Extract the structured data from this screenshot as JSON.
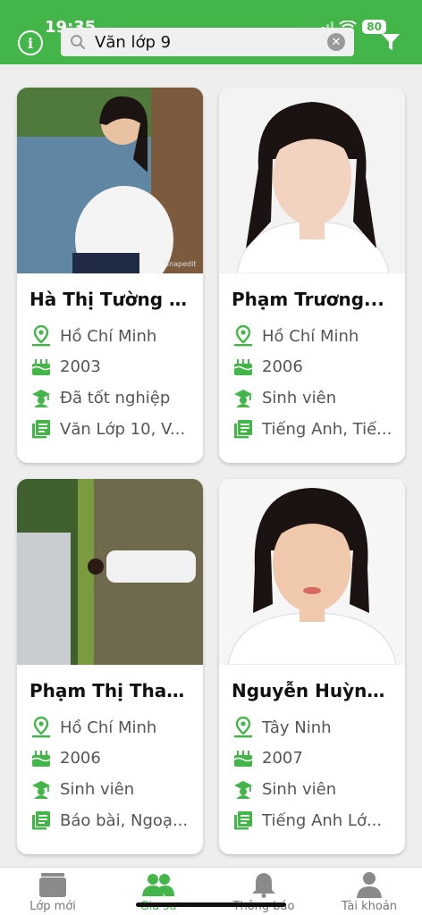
{
  "status_bar": {
    "time": "19:35",
    "battery": "80"
  },
  "header": {
    "search": {
      "value": "Văn lớp 9"
    },
    "clear_icon": "close-circle-icon",
    "info_icon": "info-icon",
    "filter_icon": "filter-icon"
  },
  "tutors": [
    {
      "name": "Hà Thị Tường Vy",
      "location": "Hồ Chí Minh",
      "birth_year": "2003",
      "status": "Đã tốt nghiệp",
      "subjects": "Văn Lớp 10, V..."
    },
    {
      "name": "Phạm Trương...",
      "location": "Hồ Chí Minh",
      "birth_year": "2006",
      "status": "Sinh viên",
      "subjects": "Tiếng Anh, Tiế..."
    },
    {
      "name": "Phạm Thị Than...",
      "location": "Hồ Chí Minh",
      "birth_year": "2006",
      "status": "Sinh viên",
      "subjects": "Báo bài, Ngoạ..."
    },
    {
      "name": "Nguyễn Huỳnh...",
      "location": "Tây Ninh",
      "birth_year": "2007",
      "status": "Sinh viên",
      "subjects": "Tiếng Anh Lớ..."
    }
  ],
  "bottom_nav": [
    {
      "label": "Lớp mới",
      "icon": "class-icon"
    },
    {
      "label": "Gia sư",
      "icon": "tutors-icon",
      "active": true
    },
    {
      "label": "Thông báo",
      "icon": "bell-icon"
    },
    {
      "label": "Tài khoản",
      "icon": "account-icon"
    }
  ],
  "colors": {
    "brand_green": "#43b549",
    "text_gray": "#555555"
  }
}
